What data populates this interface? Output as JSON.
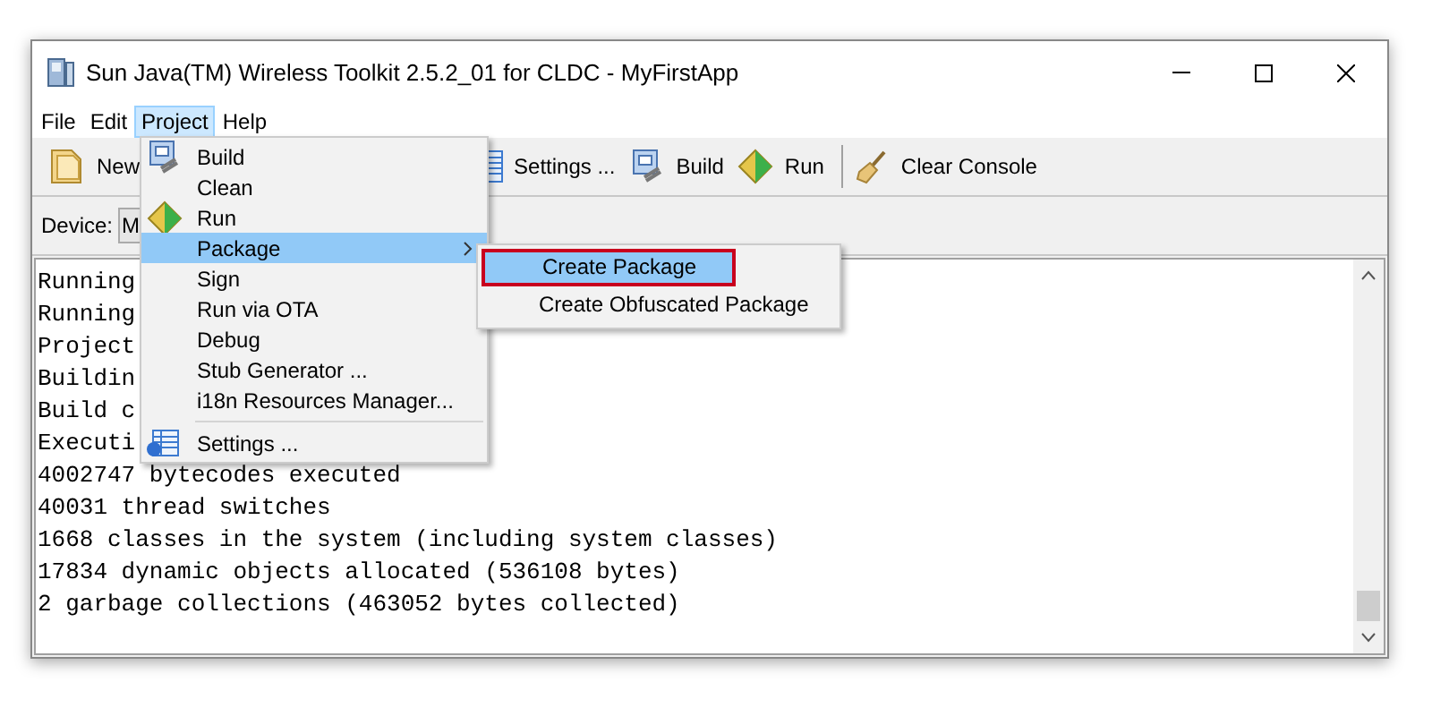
{
  "window": {
    "title": "Sun Java(TM) Wireless Toolkit 2.5.2_01 for CLDC - MyFirstApp"
  },
  "menu_bar": [
    {
      "label": "File",
      "selected": false
    },
    {
      "label": "Edit",
      "selected": false
    },
    {
      "label": "Project",
      "selected": true
    },
    {
      "label": "Help",
      "selected": false
    }
  ],
  "toolbar": [
    {
      "kind": "button",
      "label": "New"
    },
    {
      "kind": "button",
      "label": "Settings ..."
    },
    {
      "kind": "button",
      "label": "Build"
    },
    {
      "kind": "button",
      "label": "Run"
    },
    {
      "kind": "separator"
    },
    {
      "kind": "button",
      "label": "Clear Console"
    }
  ],
  "device": {
    "label": "Device:",
    "value": "M"
  },
  "project_menu": [
    {
      "kind": "item",
      "label": "Build",
      "selected": false,
      "submenu": false
    },
    {
      "kind": "item",
      "label": "Clean",
      "selected": false,
      "submenu": false
    },
    {
      "kind": "item",
      "label": "Run",
      "selected": false,
      "submenu": false
    },
    {
      "kind": "item",
      "label": "Package",
      "selected": true,
      "submenu": true
    },
    {
      "kind": "item",
      "label": "Sign",
      "selected": false,
      "submenu": false
    },
    {
      "kind": "item",
      "label": "Run via OTA",
      "selected": false,
      "submenu": false
    },
    {
      "kind": "item",
      "label": "Debug",
      "selected": false,
      "submenu": false
    },
    {
      "kind": "item",
      "label": "Stub Generator ...",
      "selected": false,
      "submenu": false
    },
    {
      "kind": "item",
      "label": "i18n Resources Manager...",
      "selected": false,
      "submenu": false
    },
    {
      "kind": "separator"
    },
    {
      "kind": "item",
      "label": "Settings ...",
      "selected": false,
      "submenu": false
    }
  ],
  "package_submenu": [
    {
      "label": "Create Package",
      "selected": true,
      "outlined": true
    },
    {
      "label": "Create Obfuscated Package",
      "selected": false,
      "outlined": false
    }
  ],
  "console": [
    "Running",
    "Running",
    "Project",
    "Buildin",
    "Build c",
    "Executi",
    "4002747 bytecodes executed",
    "40031 thread switches",
    "1668 classes in the system (including system classes)",
    "17834 dynamic objects allocated (536108 bytes)",
    "2 garbage collections (463052 bytes collected)"
  ]
}
